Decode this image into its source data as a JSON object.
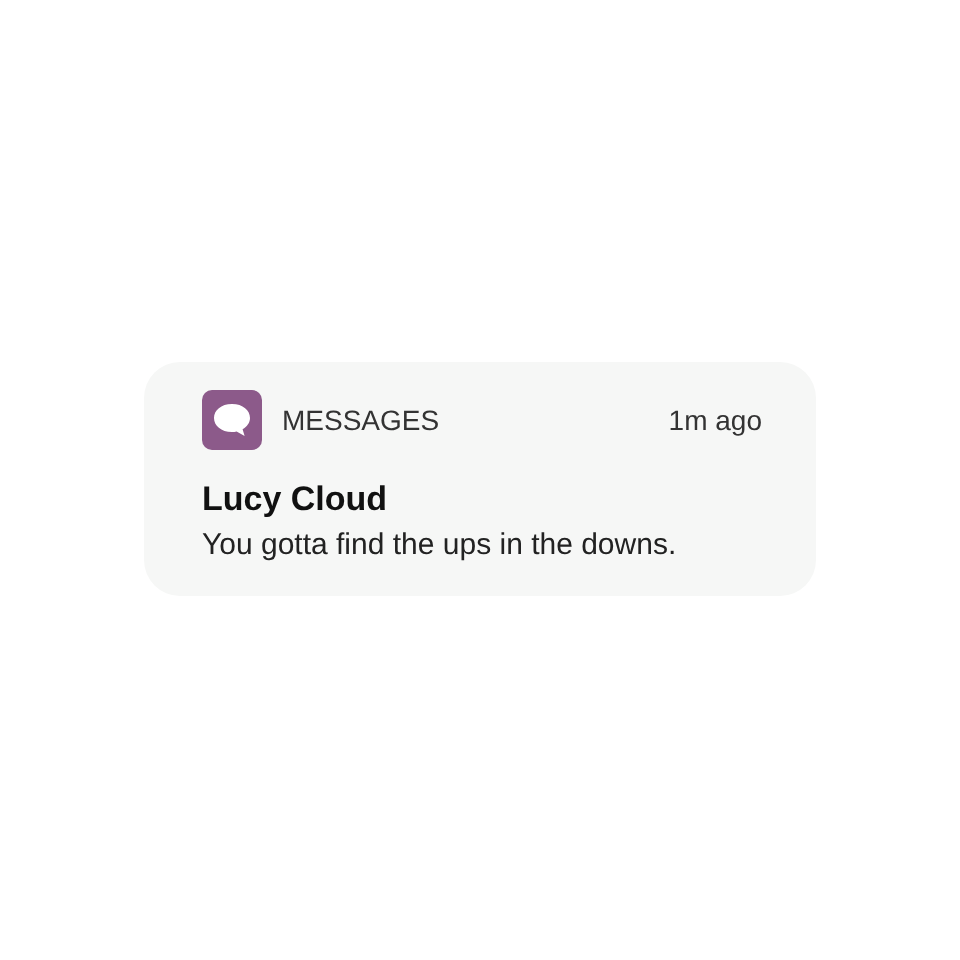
{
  "notification": {
    "app": "MESSAGES",
    "time": "1m ago",
    "title": "Lucy Cloud",
    "body": "You gotta find the ups in the downs."
  }
}
